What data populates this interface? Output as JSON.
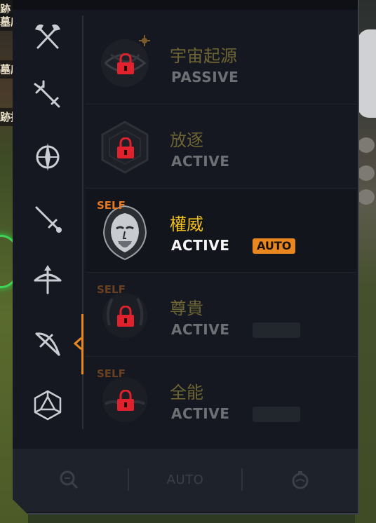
{
  "background": {
    "left_banner_texts": [
      "跡",
      "墓店",
      "墓店",
      "跡持"
    ]
  },
  "rail": {
    "categories": [
      {
        "icon": "crossed-axes-icon"
      },
      {
        "icon": "trident-icon"
      },
      {
        "icon": "sun-blade-icon"
      },
      {
        "icon": "dagger-icon"
      },
      {
        "icon": "crossbow-icon"
      },
      {
        "icon": "bow-icon",
        "active": true
      },
      {
        "icon": "polyhedron-icon"
      }
    ],
    "accent_color": "#e8861f"
  },
  "skills": [
    {
      "name": "宇宙起源",
      "type": "PASSIVE",
      "locked": true,
      "self": false,
      "auto": false
    },
    {
      "name": "放逐",
      "type": "ACTIVE",
      "locked": true,
      "self": false,
      "auto": false
    },
    {
      "name": "權威",
      "type": "ACTIVE",
      "locked": false,
      "self": true,
      "self_label": "SELF",
      "auto": true,
      "auto_label": "AUTO"
    },
    {
      "name": "尊貴",
      "type": "ACTIVE",
      "locked": true,
      "self": true,
      "self_label": "SELF",
      "auto": false
    },
    {
      "name": "全能",
      "type": "ACTIVE",
      "locked": true,
      "self": true,
      "self_label": "SELF",
      "auto": false
    }
  ],
  "bottom_bar": {
    "auto_label": "AUTO"
  },
  "colors": {
    "selected_name": "#f3c21a",
    "lock_red": "#e0222e",
    "self_orange": "#e8771f"
  }
}
